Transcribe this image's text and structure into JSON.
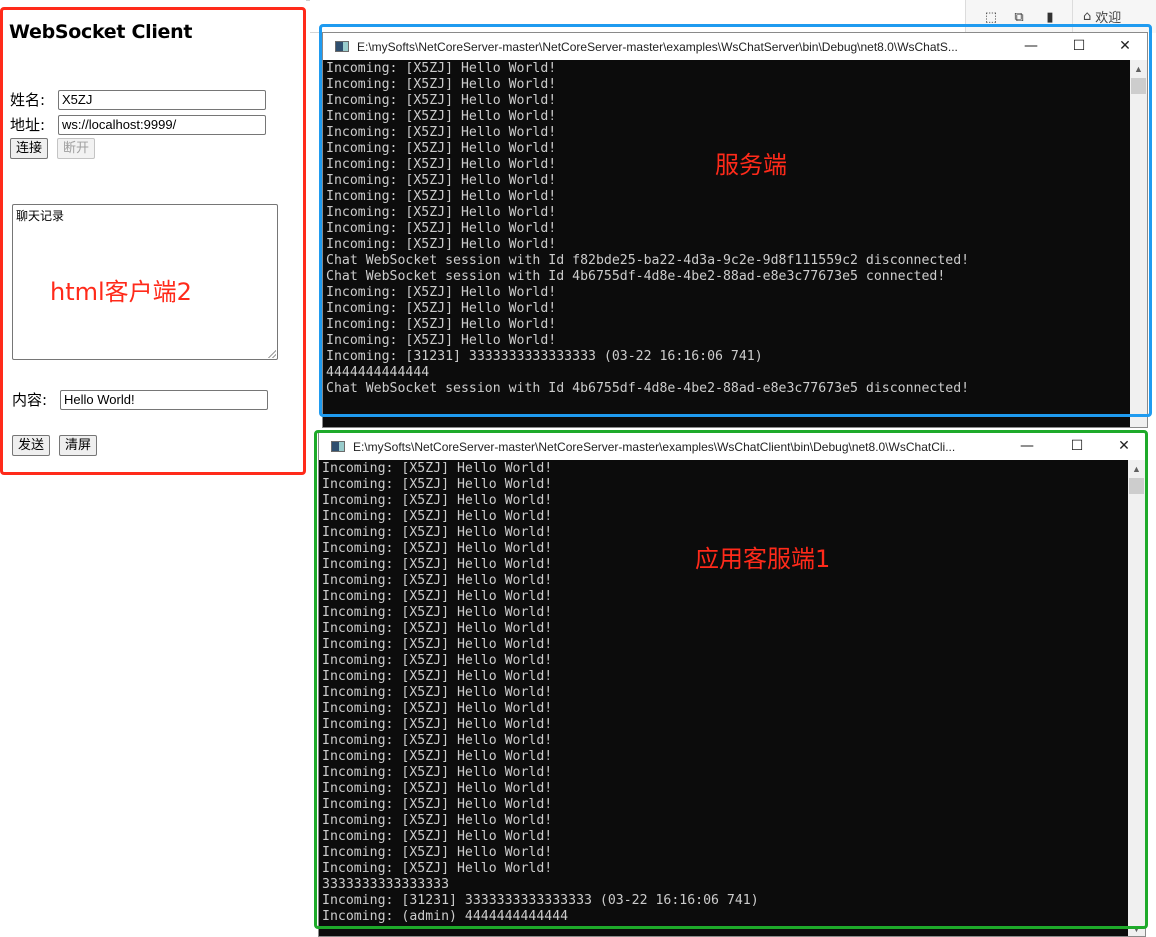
{
  "html_client": {
    "title": "WebSocket Client",
    "name_label": "姓名:",
    "name_value": "X5ZJ",
    "address_label": "地址:",
    "address_value": "ws://localhost:9999/",
    "connect_button": "连接",
    "disconnect_button": "断开",
    "chat_log_text": "聊天记录",
    "content_label": "内容:",
    "content_value": "Hello World!",
    "send_button": "发送",
    "clear_button": "清屏"
  },
  "annotations": {
    "html_client": "html客户端2",
    "server": "服务端",
    "app_client": "应用客服端1"
  },
  "frame_colors": {
    "html_client": "#ff2a1a",
    "server": "#1f9bf0",
    "app_client": "#1eaa2a"
  },
  "host_window": {
    "tab_label": "欢迎"
  },
  "server_window": {
    "title": "E:\\mySofts\\NetCoreServer-master\\NetCoreServer-master\\examples\\WsChatServer\\bin\\Debug\\net8.0\\WsChatS...",
    "minimize": "—",
    "maximize": "☐",
    "close": "✕",
    "lines": [
      "Incoming: [X5ZJ] Hello World!",
      "Incoming: [X5ZJ] Hello World!",
      "Incoming: [X5ZJ] Hello World!",
      "Incoming: [X5ZJ] Hello World!",
      "Incoming: [X5ZJ] Hello World!",
      "Incoming: [X5ZJ] Hello World!",
      "Incoming: [X5ZJ] Hello World!",
      "Incoming: [X5ZJ] Hello World!",
      "Incoming: [X5ZJ] Hello World!",
      "Incoming: [X5ZJ] Hello World!",
      "Incoming: [X5ZJ] Hello World!",
      "Incoming: [X5ZJ] Hello World!",
      "Chat WebSocket session with Id f82bde25-ba22-4d3a-9c2e-9d8f111559c2 disconnected!",
      "Chat WebSocket session with Id 4b6755df-4d8e-4be2-88ad-e8e3c77673e5 connected!",
      "Incoming: [X5ZJ] Hello World!",
      "Incoming: [X5ZJ] Hello World!",
      "Incoming: [X5ZJ] Hello World!",
      "Incoming: [X5ZJ] Hello World!",
      "Incoming: [31231] 3333333333333333 (03-22 16:16:06 741)",
      "4444444444444",
      "Chat WebSocket session with Id 4b6755df-4d8e-4be2-88ad-e8e3c77673e5 disconnected!"
    ]
  },
  "client_window": {
    "title": "E:\\mySofts\\NetCoreServer-master\\NetCoreServer-master\\examples\\WsChatClient\\bin\\Debug\\net8.0\\WsChatCli...",
    "minimize": "—",
    "maximize": "☐",
    "close": "✕",
    "lines": [
      "Incoming: [X5ZJ] Hello World!",
      "Incoming: [X5ZJ] Hello World!",
      "Incoming: [X5ZJ] Hello World!",
      "Incoming: [X5ZJ] Hello World!",
      "Incoming: [X5ZJ] Hello World!",
      "Incoming: [X5ZJ] Hello World!",
      "Incoming: [X5ZJ] Hello World!",
      "Incoming: [X5ZJ] Hello World!",
      "Incoming: [X5ZJ] Hello World!",
      "Incoming: [X5ZJ] Hello World!",
      "Incoming: [X5ZJ] Hello World!",
      "Incoming: [X5ZJ] Hello World!",
      "Incoming: [X5ZJ] Hello World!",
      "Incoming: [X5ZJ] Hello World!",
      "Incoming: [X5ZJ] Hello World!",
      "Incoming: [X5ZJ] Hello World!",
      "Incoming: [X5ZJ] Hello World!",
      "Incoming: [X5ZJ] Hello World!",
      "Incoming: [X5ZJ] Hello World!",
      "Incoming: [X5ZJ] Hello World!",
      "Incoming: [X5ZJ] Hello World!",
      "Incoming: [X5ZJ] Hello World!",
      "Incoming: [X5ZJ] Hello World!",
      "Incoming: [X5ZJ] Hello World!",
      "Incoming: [X5ZJ] Hello World!",
      "Incoming: [X5ZJ] Hello World!",
      "3333333333333333",
      "Incoming: [31231] 3333333333333333 (03-22 16:16:06 741)",
      "Incoming: (admin) 4444444444444"
    ]
  }
}
